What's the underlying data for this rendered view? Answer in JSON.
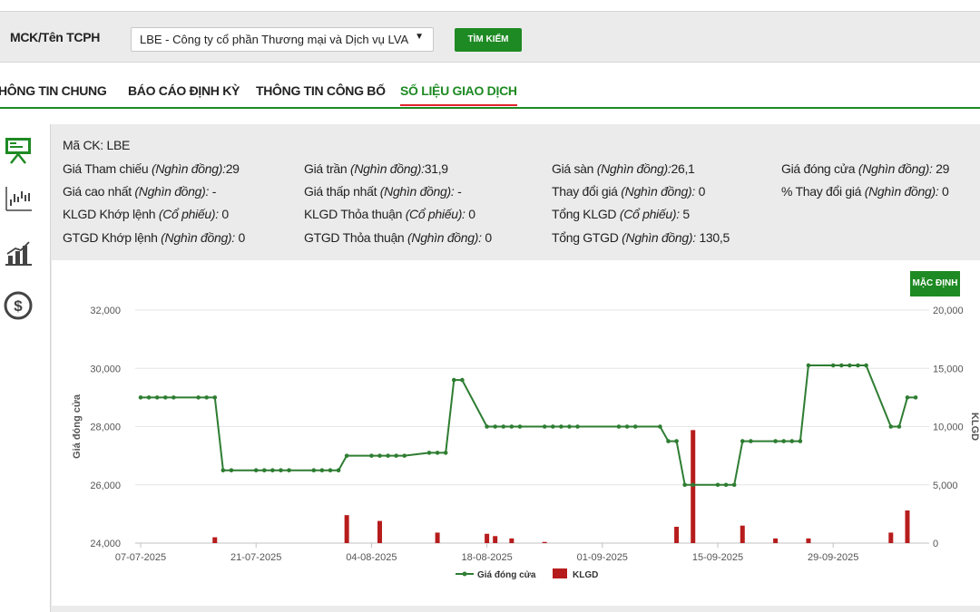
{
  "search": {
    "label": "MCK/Tên TCPH",
    "selected": "LBE - Công ty cổ phần Thương mại và Dịch vụ LVA",
    "button": "TÌM KIẾM"
  },
  "tabs": [
    {
      "label": "HÔNG TIN CHUNG",
      "active": false
    },
    {
      "label": "BÁO CÁO ĐỊNH KỲ",
      "active": false
    },
    {
      "label": "THÔNG TIN CÔNG BỐ",
      "active": false
    },
    {
      "label": "SỐ LIỆU GIAO DỊCH",
      "active": true
    }
  ],
  "rail_icons": [
    "presentation-icon",
    "candlestick-icon",
    "bar-chart-icon",
    "dollar-icon"
  ],
  "info": {
    "ma_ck": {
      "key": "Mã CK:",
      "value": " LBE"
    },
    "rows": [
      [
        {
          "key": "Giá Tham chiếu ",
          "unit": "(Nghìn đồng):",
          "value": "29"
        },
        {
          "key": "Giá trần ",
          "unit": "(Nghìn đồng):",
          "value": "31,9"
        },
        {
          "key": "Giá sàn ",
          "unit": "(Nghìn đồng):",
          "value": "26,1"
        },
        {
          "key": "Giá đóng cửa ",
          "unit": "(Nghìn đồng):",
          "value": " 29"
        }
      ],
      [
        {
          "key": "Giá cao nhất ",
          "unit": "(Nghìn đồng):",
          "value": " -"
        },
        {
          "key": "Giá thấp nhất ",
          "unit": "(Nghìn đồng):",
          "value": " -"
        },
        {
          "key": "Thay đổi giá ",
          "unit": "(Nghìn đồng):",
          "value": " 0"
        },
        {
          "key": "% Thay đổi giá ",
          "unit": "(Nghìn đồng):",
          "value": " 0"
        }
      ],
      [
        {
          "key": "KLGD Khớp lệnh ",
          "unit": "(Cổ phiếu):",
          "value": " 0"
        },
        {
          "key": "KLGD Thỏa thuận ",
          "unit": "(Cổ phiếu):",
          "value": " 0"
        },
        {
          "key": "Tổng KLGD ",
          "unit": "(Cổ phiếu):",
          "value": " 5"
        },
        {
          "key": "",
          "unit": "",
          "value": ""
        }
      ],
      [
        {
          "key": "GTGD Khớp lệnh ",
          "unit": "(Nghìn đồng):",
          "value": " 0"
        },
        {
          "key": "GTGD Thỏa thuận ",
          "unit": "(Nghìn đồng):",
          "value": " 0"
        },
        {
          "key": "Tổng GTGD ",
          "unit": "(Nghìn đồng):",
          "value": " 130,5"
        },
        {
          "key": "",
          "unit": "",
          "value": ""
        }
      ]
    ]
  },
  "chart_button": "MẶC ĐỊNH",
  "colors": {
    "accent": "#1e8a23",
    "tab_underline": "#e0232b",
    "line": "#2e7d32",
    "bar": "#b71c1c"
  },
  "chart_data": {
    "type": "line+bar",
    "x_start": "07-07-2025",
    "x_ticks": [
      "07-07-2025",
      "21-07-2025",
      "04-08-2025",
      "18-08-2025",
      "01-09-2025",
      "15-09-2025",
      "29-09-2025"
    ],
    "ylabel": "Giá đóng cửa",
    "ylabel_right": "KLGD",
    "ylim": [
      24000,
      32000
    ],
    "yticks": [
      "24,000",
      "26,000",
      "28,000",
      "30,000",
      "32,000"
    ],
    "ylim_right": [
      0,
      20000
    ],
    "yticks_right": [
      "0",
      "5,000",
      "10,000",
      "15,000",
      "20,000"
    ],
    "series": [
      {
        "name": "Giá đóng cửa",
        "kind": "line",
        "points": [
          {
            "d": "07-07-2025",
            "v": 29000
          },
          {
            "d": "08-07-2025",
            "v": 29000
          },
          {
            "d": "09-07-2025",
            "v": 29000
          },
          {
            "d": "10-07-2025",
            "v": 29000
          },
          {
            "d": "11-07-2025",
            "v": 29000
          },
          {
            "d": "14-07-2025",
            "v": 29000
          },
          {
            "d": "15-07-2025",
            "v": 29000
          },
          {
            "d": "16-07-2025",
            "v": 29000
          },
          {
            "d": "17-07-2025",
            "v": 26500
          },
          {
            "d": "18-07-2025",
            "v": 26500
          },
          {
            "d": "21-07-2025",
            "v": 26500
          },
          {
            "d": "22-07-2025",
            "v": 26500
          },
          {
            "d": "23-07-2025",
            "v": 26500
          },
          {
            "d": "24-07-2025",
            "v": 26500
          },
          {
            "d": "25-07-2025",
            "v": 26500
          },
          {
            "d": "28-07-2025",
            "v": 26500
          },
          {
            "d": "29-07-2025",
            "v": 26500
          },
          {
            "d": "30-07-2025",
            "v": 26500
          },
          {
            "d": "31-07-2025",
            "v": 26500
          },
          {
            "d": "01-08-2025",
            "v": 27000
          },
          {
            "d": "04-08-2025",
            "v": 27000
          },
          {
            "d": "05-08-2025",
            "v": 27000
          },
          {
            "d": "06-08-2025",
            "v": 27000
          },
          {
            "d": "07-08-2025",
            "v": 27000
          },
          {
            "d": "08-08-2025",
            "v": 27000
          },
          {
            "d": "11-08-2025",
            "v": 27100
          },
          {
            "d": "12-08-2025",
            "v": 27100
          },
          {
            "d": "13-08-2025",
            "v": 27100
          },
          {
            "d": "14-08-2025",
            "v": 29600
          },
          {
            "d": "15-08-2025",
            "v": 29600
          },
          {
            "d": "18-08-2025",
            "v": 28000
          },
          {
            "d": "19-08-2025",
            "v": 28000
          },
          {
            "d": "20-08-2025",
            "v": 28000
          },
          {
            "d": "21-08-2025",
            "v": 28000
          },
          {
            "d": "22-08-2025",
            "v": 28000
          },
          {
            "d": "25-08-2025",
            "v": 28000
          },
          {
            "d": "26-08-2025",
            "v": 28000
          },
          {
            "d": "27-08-2025",
            "v": 28000
          },
          {
            "d": "28-08-2025",
            "v": 28000
          },
          {
            "d": "29-08-2025",
            "v": 28000
          },
          {
            "d": "03-09-2025",
            "v": 28000
          },
          {
            "d": "04-09-2025",
            "v": 28000
          },
          {
            "d": "05-09-2025",
            "v": 28000
          },
          {
            "d": "08-09-2025",
            "v": 28000
          },
          {
            "d": "09-09-2025",
            "v": 27500
          },
          {
            "d": "10-09-2025",
            "v": 27500
          },
          {
            "d": "11-09-2025",
            "v": 26000
          },
          {
            "d": "12-09-2025",
            "v": 26000
          },
          {
            "d": "15-09-2025",
            "v": 26000
          },
          {
            "d": "16-09-2025",
            "v": 26000
          },
          {
            "d": "17-09-2025",
            "v": 26000
          },
          {
            "d": "18-09-2025",
            "v": 27500
          },
          {
            "d": "19-09-2025",
            "v": 27500
          },
          {
            "d": "22-09-2025",
            "v": 27500
          },
          {
            "d": "23-09-2025",
            "v": 27500
          },
          {
            "d": "24-09-2025",
            "v": 27500
          },
          {
            "d": "25-09-2025",
            "v": 27500
          },
          {
            "d": "26-09-2025",
            "v": 30100
          },
          {
            "d": "29-09-2025",
            "v": 30100
          },
          {
            "d": "30-09-2025",
            "v": 30100
          },
          {
            "d": "01-10-2025",
            "v": 30100
          },
          {
            "d": "02-10-2025",
            "v": 30100
          },
          {
            "d": "03-10-2025",
            "v": 30100
          },
          {
            "d": "06-10-2025",
            "v": 28000
          },
          {
            "d": "07-10-2025",
            "v": 28000
          },
          {
            "d": "08-10-2025",
            "v": 29000
          },
          {
            "d": "09-10-2025",
            "v": 29000
          }
        ]
      },
      {
        "name": "KLGD",
        "kind": "bar",
        "points": [
          {
            "d": "16-07-2025",
            "v": 500
          },
          {
            "d": "01-08-2025",
            "v": 2400
          },
          {
            "d": "05-08-2025",
            "v": 1900
          },
          {
            "d": "12-08-2025",
            "v": 900
          },
          {
            "d": "18-08-2025",
            "v": 800
          },
          {
            "d": "19-08-2025",
            "v": 600
          },
          {
            "d": "21-08-2025",
            "v": 400
          },
          {
            "d": "25-08-2025",
            "v": 100
          },
          {
            "d": "10-09-2025",
            "v": 1400
          },
          {
            "d": "12-09-2025",
            "v": 9700
          },
          {
            "d": "18-09-2025",
            "v": 1500
          },
          {
            "d": "22-09-2025",
            "v": 400
          },
          {
            "d": "26-09-2025",
            "v": 400
          },
          {
            "d": "06-10-2025",
            "v": 900
          },
          {
            "d": "08-10-2025",
            "v": 2800
          }
        ]
      }
    ],
    "legend": "bottom-center",
    "grid": true
  }
}
